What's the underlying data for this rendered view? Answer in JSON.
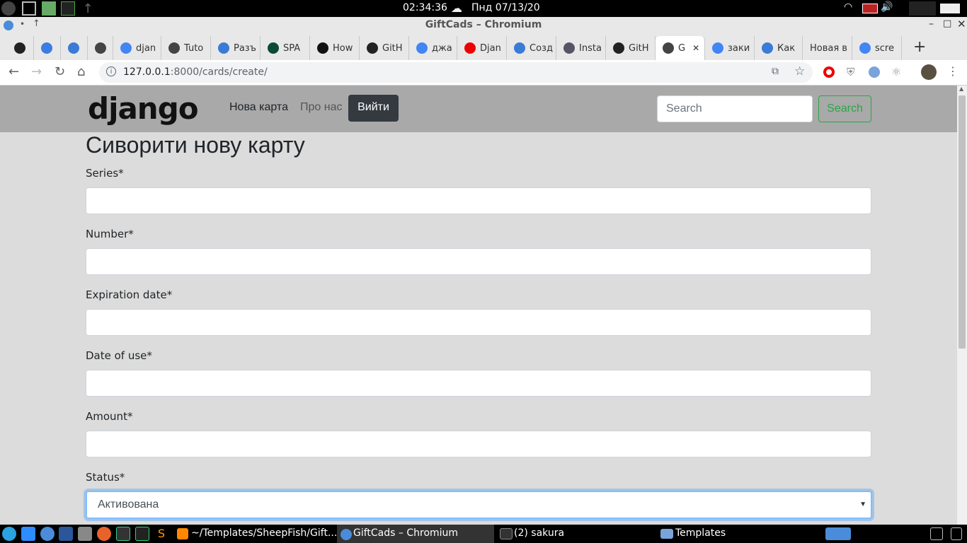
{
  "system": {
    "clock": "02:34:36",
    "date": "Пнд 07/13/20"
  },
  "window": {
    "title": "GiftCads – Chromium"
  },
  "tabs": [
    {
      "label": "",
      "icon": "github-icon"
    },
    {
      "label": "",
      "icon": "contacts-icon"
    },
    {
      "label": "",
      "icon": "app-icon"
    },
    {
      "label": "",
      "icon": "globe-icon"
    },
    {
      "label": "djan",
      "icon": "google-icon"
    },
    {
      "label": "Tuto",
      "icon": "globe-icon"
    },
    {
      "label": "Разъ",
      "icon": "app-icon"
    },
    {
      "label": "SPA",
      "icon": "django-icon"
    },
    {
      "label": "How",
      "icon": "g-icon"
    },
    {
      "label": "GitH",
      "icon": "github-icon"
    },
    {
      "label": "джа",
      "icon": "google-icon"
    },
    {
      "label": "Djan",
      "icon": "youtube-icon"
    },
    {
      "label": "Созд",
      "icon": "app-icon"
    },
    {
      "label": "Insta",
      "icon": "doc-icon"
    },
    {
      "label": "GitH",
      "icon": "github-icon"
    },
    {
      "label": "G",
      "icon": "globe-icon"
    },
    {
      "label": "заки",
      "icon": "google-icon"
    },
    {
      "label": "Как",
      "icon": "app-icon"
    },
    {
      "label": "Новая в",
      "icon": ""
    },
    {
      "label": "scre",
      "icon": "google-icon"
    }
  ],
  "address": {
    "host": "127.0.0.1",
    "path": ":8000/cards/create/"
  },
  "navbar": {
    "logo": "django",
    "new_card": "Нова карта",
    "about": "Про нас",
    "logout": "Вийти",
    "search_placeholder": "Search",
    "search_button": "Search"
  },
  "form": {
    "heading": "Сиворити нову карту",
    "fields": [
      {
        "label": "Series*"
      },
      {
        "label": "Number*"
      },
      {
        "label": "Expiration date*"
      },
      {
        "label": "Date of use*"
      },
      {
        "label": "Amount*"
      }
    ],
    "status": {
      "label": "Status*",
      "value": "Активована"
    }
  },
  "taskbar": {
    "items": [
      "~/Templates/SheepFish/Gift...",
      "GiftCads – Chromium",
      "(2) sakura",
      "Templates"
    ]
  }
}
